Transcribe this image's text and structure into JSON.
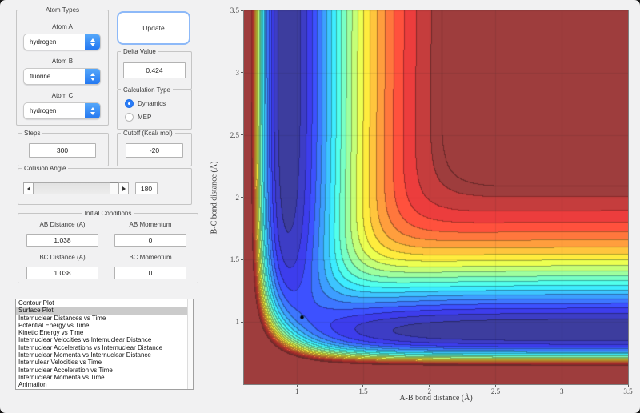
{
  "atom_types_panel": {
    "title": "Atom Types",
    "fields": [
      {
        "label": "Atom A",
        "value": "hydrogen"
      },
      {
        "label": "Atom B",
        "value": "fluorine"
      },
      {
        "label": "Atom C",
        "value": "hydrogen"
      }
    ]
  },
  "update_button": {
    "label": "Update"
  },
  "delta_panel": {
    "title": "Delta Value",
    "value": "0.424"
  },
  "calc_type_panel": {
    "title": "Calculation Type",
    "options": [
      {
        "label": "Dynamics",
        "selected": true
      },
      {
        "label": "MEP",
        "selected": false
      }
    ]
  },
  "steps_panel": {
    "title": "Steps",
    "value": "300"
  },
  "cutoff_panel": {
    "title": "Cutoff (Kcal/ mol)",
    "value": "-20"
  },
  "collision_panel": {
    "title": "Collision Angle",
    "value": "180"
  },
  "initial_conditions_panel": {
    "title": "Initial Conditions",
    "fields": [
      {
        "label": "AB Distance (A)",
        "value": "1.038"
      },
      {
        "label": "AB Momentum",
        "value": "0"
      },
      {
        "label": "BC Distance (A)",
        "value": "1.038"
      },
      {
        "label": "BC Momentum",
        "value": "0"
      }
    ]
  },
  "plot_list": {
    "selected_index": 1,
    "items": [
      "Contour Plot",
      "Surface Plot",
      "Internuclear Distances vs Time",
      "Potential Energy vs Time",
      "Kinetic Energy vs Time",
      "Internuclear Velocities vs Internuclear Distance",
      "Internuclear Accelerations vs Internuclear Distance",
      "Internuclear Momenta vs Internuclear Distance",
      "Internulear Velocities vs Time",
      "Internuclear Acceleration vs Time",
      "Internuclear Momenta vs Time",
      "Animation"
    ]
  },
  "chart_data": {
    "type": "contour",
    "title": "",
    "xlabel": "A-B bond distance (Å)",
    "ylabel": "B-C bond distance (Å)",
    "xlim": [
      0.6,
      3.5
    ],
    "ylim": [
      0.5,
      3.5
    ],
    "xticks": [
      1,
      1.5,
      2,
      2.5,
      3,
      3.5
    ],
    "yticks": [
      1,
      1.5,
      2,
      2.5,
      3,
      3.5
    ],
    "grid": true,
    "colormap": "jet",
    "levels": 20,
    "cutoff_kcal": -20,
    "surface": {
      "model": "leps-collinear",
      "morse_D": 1,
      "morse_a": 2.4,
      "morse_r0": 0.93,
      "sato": 0,
      "well_norm": -1,
      "cutoff_norm": -0.143,
      "outer_line_norm": -0.118
    },
    "marker": {
      "x": 1.038,
      "y": 1.038,
      "color": "#000000"
    },
    "description": "Filled contour (jet colormap) of the H-F-H potential energy surface: L-shaped blue valley along A-B ≈ 0.93 Å and B-C ≈ 0.93 Å, steep repulsive wall at short distances and uniform dark-red plateau above the -20 kcal/mol cutoff; black marker at initial geometry."
  }
}
